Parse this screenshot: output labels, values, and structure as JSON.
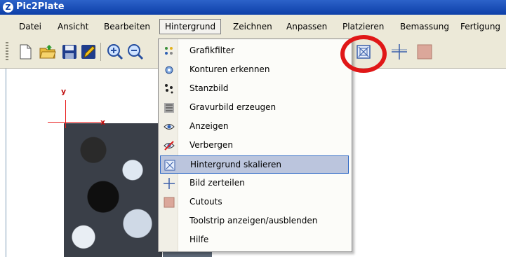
{
  "window": {
    "title": "Pic2Plate",
    "icon": "pic2plate-logo-icon"
  },
  "menubar": {
    "items": [
      {
        "label": "Datei"
      },
      {
        "label": "Ansicht"
      },
      {
        "label": "Bearbeiten"
      },
      {
        "label": "Hintergrund",
        "open": true
      },
      {
        "label": "Zeichnen"
      },
      {
        "label": "Anpassen"
      },
      {
        "label": "Platzieren"
      },
      {
        "label": "Bemassung"
      },
      {
        "label": "Fertigung"
      }
    ]
  },
  "toolbar": {
    "icons": [
      "new-document-icon",
      "open-folder-icon",
      "save-icon",
      "edit-pencil-icon",
      "zoom-in-icon",
      "zoom-out-icon",
      "scale-background-icon",
      "split-image-icon",
      "cutouts-icon"
    ]
  },
  "canvas": {
    "axis_y_label": "y",
    "axis_x_label": "x"
  },
  "dropdown": {
    "items": [
      {
        "label": "Grafikfilter",
        "icon": "graphic-filter-icon"
      },
      {
        "label": "Konturen erkennen",
        "icon": "detect-contours-icon"
      },
      {
        "label": "Stanzbild",
        "icon": "punch-image-icon"
      },
      {
        "label": "Gravurbild erzeugen",
        "icon": "engrave-image-icon"
      },
      {
        "label": "Anzeigen",
        "icon": "show-eye-icon"
      },
      {
        "label": "Verbergen",
        "icon": "hide-eye-icon"
      },
      {
        "label": "Hintergrund skalieren",
        "icon": "scale-background-icon",
        "highlighted": true
      },
      {
        "label": "Bild zerteilen",
        "icon": "split-image-icon"
      },
      {
        "label": "Cutouts",
        "icon": "cutouts-icon"
      },
      {
        "label": "Toolstrip anzeigen/ausblenden",
        "icon": ""
      },
      {
        "label": "Hilfe",
        "icon": ""
      }
    ]
  },
  "colors": {
    "title_bar": "#0d3fa8",
    "highlight": "#bbc5dd",
    "annotation": "#e01717",
    "axis": "#e81b1b"
  }
}
